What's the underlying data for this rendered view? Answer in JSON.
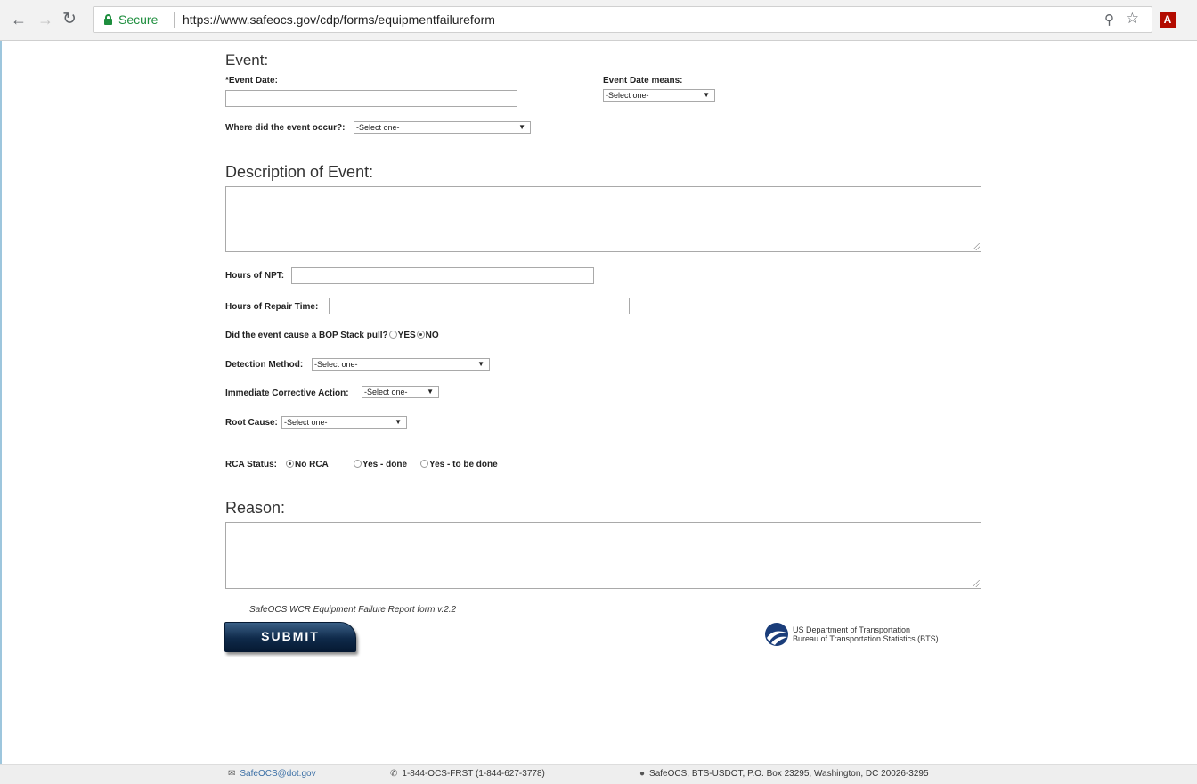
{
  "browser": {
    "secure_label": "Secure",
    "url": "https://www.safeocs.gov/cdp/forms/equipmentfailureform"
  },
  "event": {
    "title": "Event:",
    "event_date_label": "*Event Date:",
    "event_date_value": "",
    "event_date_means_label": "Event Date means:",
    "event_date_means_value": "-Select one-",
    "where_label": "Where did the event occur?:",
    "where_value": "-Select one-"
  },
  "description": {
    "title": "Description of Event:",
    "value": ""
  },
  "fields": {
    "hours_npt_label": "Hours of NPT:",
    "hours_repair_label": "Hours of Repair Time:",
    "bop_label": "Did the event cause a BOP Stack pull?",
    "bop_yes": "YES",
    "bop_no": "NO",
    "bop_selected": "NO",
    "detection_label": "Detection Method:",
    "detection_value": "-Select one-",
    "corrective_label": "Immediate Corrective Action:",
    "corrective_value": "-Select one-",
    "root_cause_label": "Root Cause:",
    "root_cause_value": "-Select one-"
  },
  "rca": {
    "label": "RCA Status:",
    "options": [
      "No RCA",
      "Yes - done",
      "Yes - to be done"
    ],
    "selected": "No RCA"
  },
  "reason": {
    "title": "Reason:",
    "value": ""
  },
  "version_note": "SafeOCS WCR Equipment Failure Report form v.2.2",
  "submit_label": "SUBMIT",
  "dot": {
    "line1": "US Department of Transportation",
    "line2": "Bureau of Transportation Statistics (BTS)"
  },
  "footer": {
    "email": "SafeOCS@dot.gov",
    "phone": "1-844-OCS-FRST (1-844-627-3778)",
    "address": "SafeOCS, BTS-USDOT, P.O. Box 23295, Washington, DC 20026-3295"
  },
  "icons": {
    "back": "back-arrow-icon",
    "forward": "forward-arrow-icon",
    "reload": "reload-icon",
    "lock": "lock-icon",
    "zoom": "zoom-icon",
    "bookmark": "star-icon",
    "pdf_extension": "acrobat-icon",
    "mail": "envelope-icon",
    "phone": "phone-icon",
    "location": "map-pin-icon"
  },
  "colors": {
    "secure_green": "#1e8e3e",
    "submit_navy": "#0f2a4a",
    "link_blue": "#3a6ea5"
  }
}
